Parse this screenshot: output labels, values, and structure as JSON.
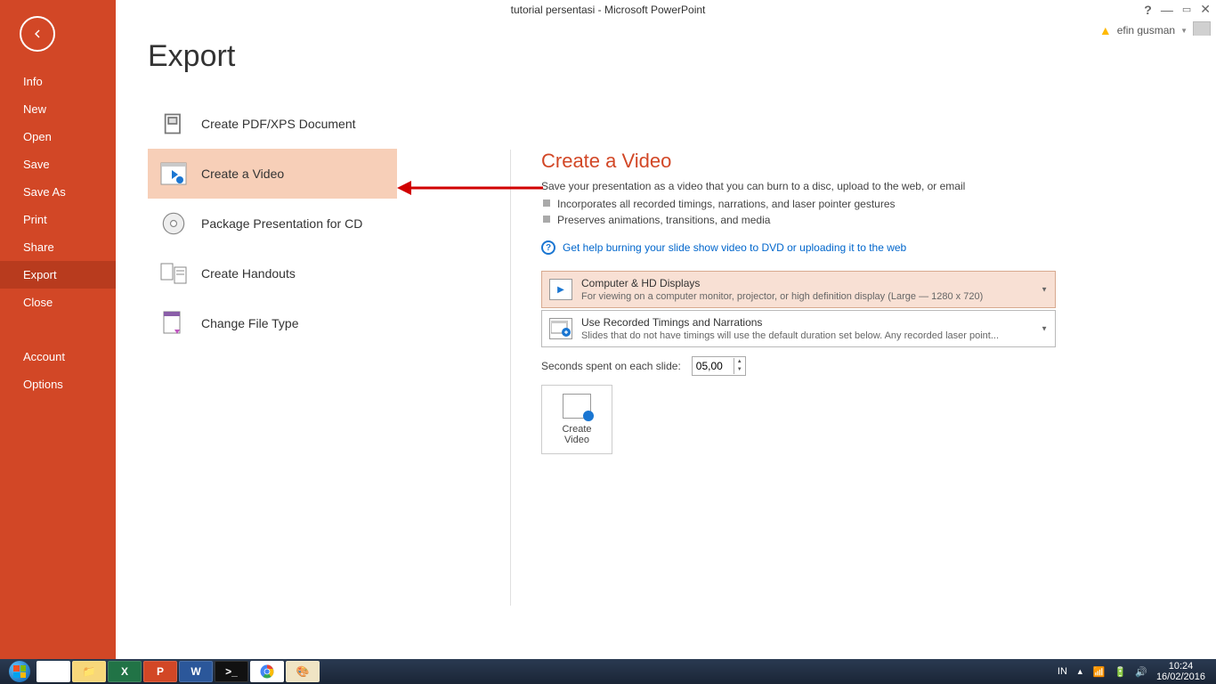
{
  "title": "tutorial persentasi - Microsoft PowerPoint",
  "user": {
    "name": "efin gusman"
  },
  "sidebar": {
    "items": [
      "Info",
      "New",
      "Open",
      "Save",
      "Save As",
      "Print",
      "Share",
      "Export",
      "Close"
    ],
    "bottom": [
      "Account",
      "Options"
    ],
    "selected_index": 7
  },
  "page": {
    "title": "Export"
  },
  "export_options": [
    {
      "label": "Create PDF/XPS Document"
    },
    {
      "label": "Create a Video"
    },
    {
      "label": "Package Presentation for CD"
    },
    {
      "label": "Create Handouts"
    },
    {
      "label": "Change File Type"
    }
  ],
  "export_selected_index": 1,
  "detail": {
    "title": "Create a Video",
    "desc": "Save your presentation as a video that you can burn to a disc, upload to the web, or email",
    "bullets": [
      "Incorporates all recorded timings, narrations, and laser pointer gestures",
      "Preserves animations, transitions, and media"
    ],
    "help": "Get help burning your slide show video to DVD or uploading it to the web",
    "combo1": {
      "title": "Computer & HD Displays",
      "sub": "For viewing on a computer monitor, projector, or high definition display  (Large — 1280 x 720)"
    },
    "combo2": {
      "title": "Use Recorded Timings and Narrations",
      "sub": "Slides that do not have timings will use the default duration set below. Any recorded laser point..."
    },
    "seconds_label": "Seconds spent on each slide:",
    "seconds_value": "05,00",
    "create_label": "Create\nVideo"
  },
  "taskbar": {
    "lang": "IN",
    "time": "10:24",
    "date": "16/02/2016"
  }
}
